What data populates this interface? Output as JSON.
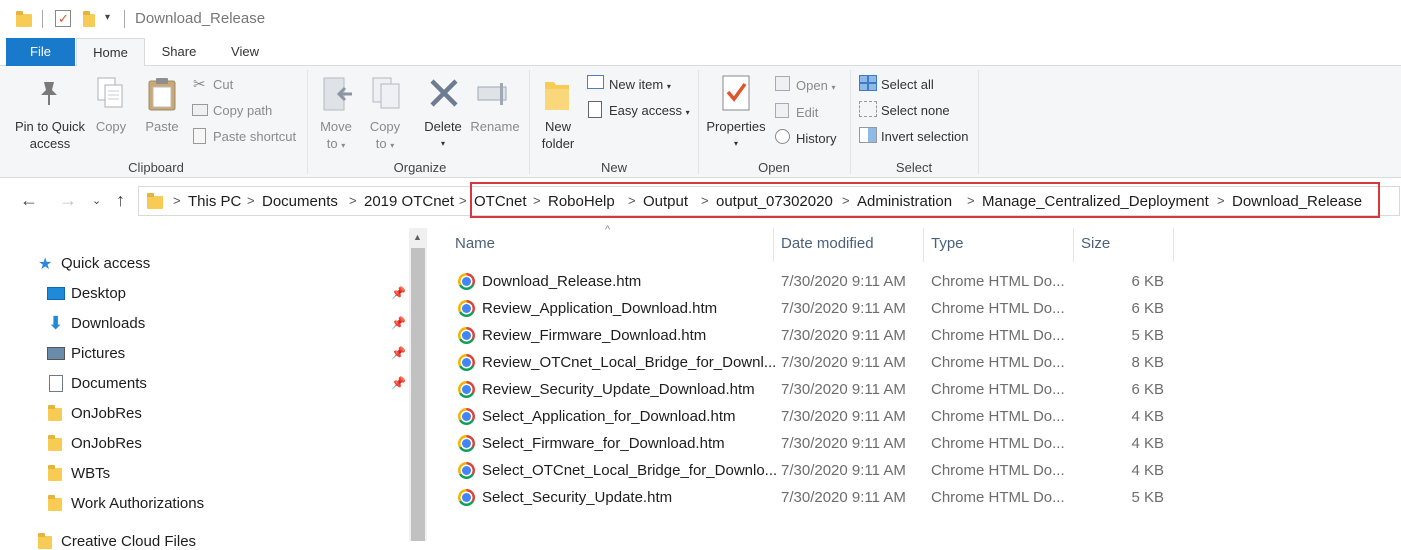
{
  "window": {
    "title": "Download_Release"
  },
  "tabs": [
    {
      "label": "File"
    },
    {
      "label": "Home"
    },
    {
      "label": "Share"
    },
    {
      "label": "View"
    }
  ],
  "ribbon": {
    "clipboard": {
      "label": "Clipboard",
      "pin": "Pin to Quick access",
      "pin_l1": "Pin to Quick",
      "pin_l2": "access",
      "copy": "Copy",
      "paste": "Paste",
      "cut": "Cut",
      "copy_path": "Copy path",
      "paste_shortcut": "Paste shortcut"
    },
    "organize": {
      "label": "Organize",
      "move_to": "Move",
      "move_to_2": "to",
      "copy_to": "Copy",
      "copy_to_2": "to",
      "delete": "Delete",
      "rename": "Rename"
    },
    "new": {
      "label": "New",
      "new_folder": "New",
      "new_folder_2": "folder",
      "new_item": "New item",
      "easy_access": "Easy access"
    },
    "open": {
      "label": "Open",
      "properties": "Properties",
      "open": "Open",
      "edit": "Edit",
      "history": "History"
    },
    "select": {
      "label": "Select",
      "select_all": "Select all",
      "select_none": "Select none",
      "invert_selection": "Invert selection"
    }
  },
  "breadcrumb": [
    "This PC",
    "Documents",
    "2019 OTCnet",
    "OTCnet",
    "RoboHelp",
    "Output",
    "output_07302020",
    "Administration",
    "Manage_Centralized_Deployment",
    "Download_Release"
  ],
  "nav": {
    "quick_access": "Quick access",
    "items": [
      {
        "label": "Desktop",
        "icon": "desktop-icon",
        "pinned": true
      },
      {
        "label": "Downloads",
        "icon": "downloads-icon",
        "pinned": true
      },
      {
        "label": "Pictures",
        "icon": "pictures-icon",
        "pinned": true
      },
      {
        "label": "Documents",
        "icon": "documents-icon",
        "pinned": true
      },
      {
        "label": "OnJobRes",
        "icon": "folder-icon",
        "pinned": false
      },
      {
        "label": "OnJobRes",
        "icon": "folder-icon",
        "pinned": false
      },
      {
        "label": "WBTs",
        "icon": "folder-icon",
        "pinned": false
      },
      {
        "label": "Work Authorizations",
        "icon": "folder-icon",
        "pinned": false
      },
      {
        "label": "Creative Cloud Files",
        "icon": "folder-icon",
        "pinned": false
      }
    ]
  },
  "columns": {
    "name": "Name",
    "date": "Date modified",
    "type": "Type",
    "size": "Size"
  },
  "files": [
    {
      "name": "Download_Release.htm",
      "date": "7/30/2020 9:11 AM",
      "type": "Chrome HTML Do...",
      "size": "6 KB"
    },
    {
      "name": "Review_Application_Download.htm",
      "date": "7/30/2020 9:11 AM",
      "type": "Chrome HTML Do...",
      "size": "6 KB"
    },
    {
      "name": "Review_Firmware_Download.htm",
      "date": "7/30/2020 9:11 AM",
      "type": "Chrome HTML Do...",
      "size": "5 KB"
    },
    {
      "name": "Review_OTCnet_Local_Bridge_for_Downl...",
      "date": "7/30/2020 9:11 AM",
      "type": "Chrome HTML Do...",
      "size": "8 KB"
    },
    {
      "name": "Review_Security_Update_Download.htm",
      "date": "7/30/2020 9:11 AM",
      "type": "Chrome HTML Do...",
      "size": "6 KB"
    },
    {
      "name": "Select_Application_for_Download.htm",
      "date": "7/30/2020 9:11 AM",
      "type": "Chrome HTML Do...",
      "size": "4 KB"
    },
    {
      "name": "Select_Firmware_for_Download.htm",
      "date": "7/30/2020 9:11 AM",
      "type": "Chrome HTML Do...",
      "size": "4 KB"
    },
    {
      "name": "Select_OTCnet_Local_Bridge_for_Downlo...",
      "date": "7/30/2020 9:11 AM",
      "type": "Chrome HTML Do...",
      "size": "4 KB"
    },
    {
      "name": "Select_Security_Update.htm",
      "date": "7/30/2020 9:11 AM",
      "type": "Chrome HTML Do...",
      "size": "5 KB"
    }
  ],
  "colors": {
    "file_tab": "#1979ca",
    "highlight_box": "#d9363e",
    "ribbon_bg": "#f5f6f7"
  }
}
